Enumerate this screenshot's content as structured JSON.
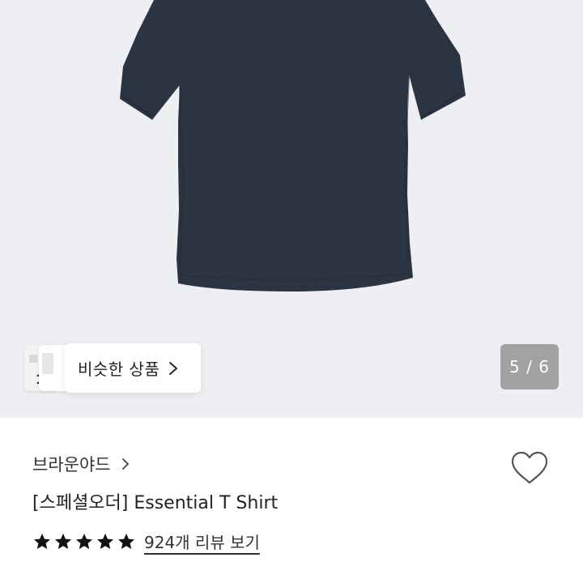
{
  "gallery": {
    "image_alt": "navy t-shirt",
    "similar_products_label": "비슷한 상품",
    "page_indicator": "5 / 6",
    "shirt_color": "#2b3442",
    "background_color": "#eeeff2"
  },
  "product": {
    "brand": "브라운야드",
    "title": "[스페셜오더] Essential T Shirt",
    "rating_stars": 5,
    "reviews_link": "924개 리뷰 보기"
  },
  "icons": {
    "brand_chevron": "chevron-right-icon",
    "similar_chevron": "chevron-right-icon",
    "wishlist": "heart-icon",
    "star": "star-icon"
  }
}
